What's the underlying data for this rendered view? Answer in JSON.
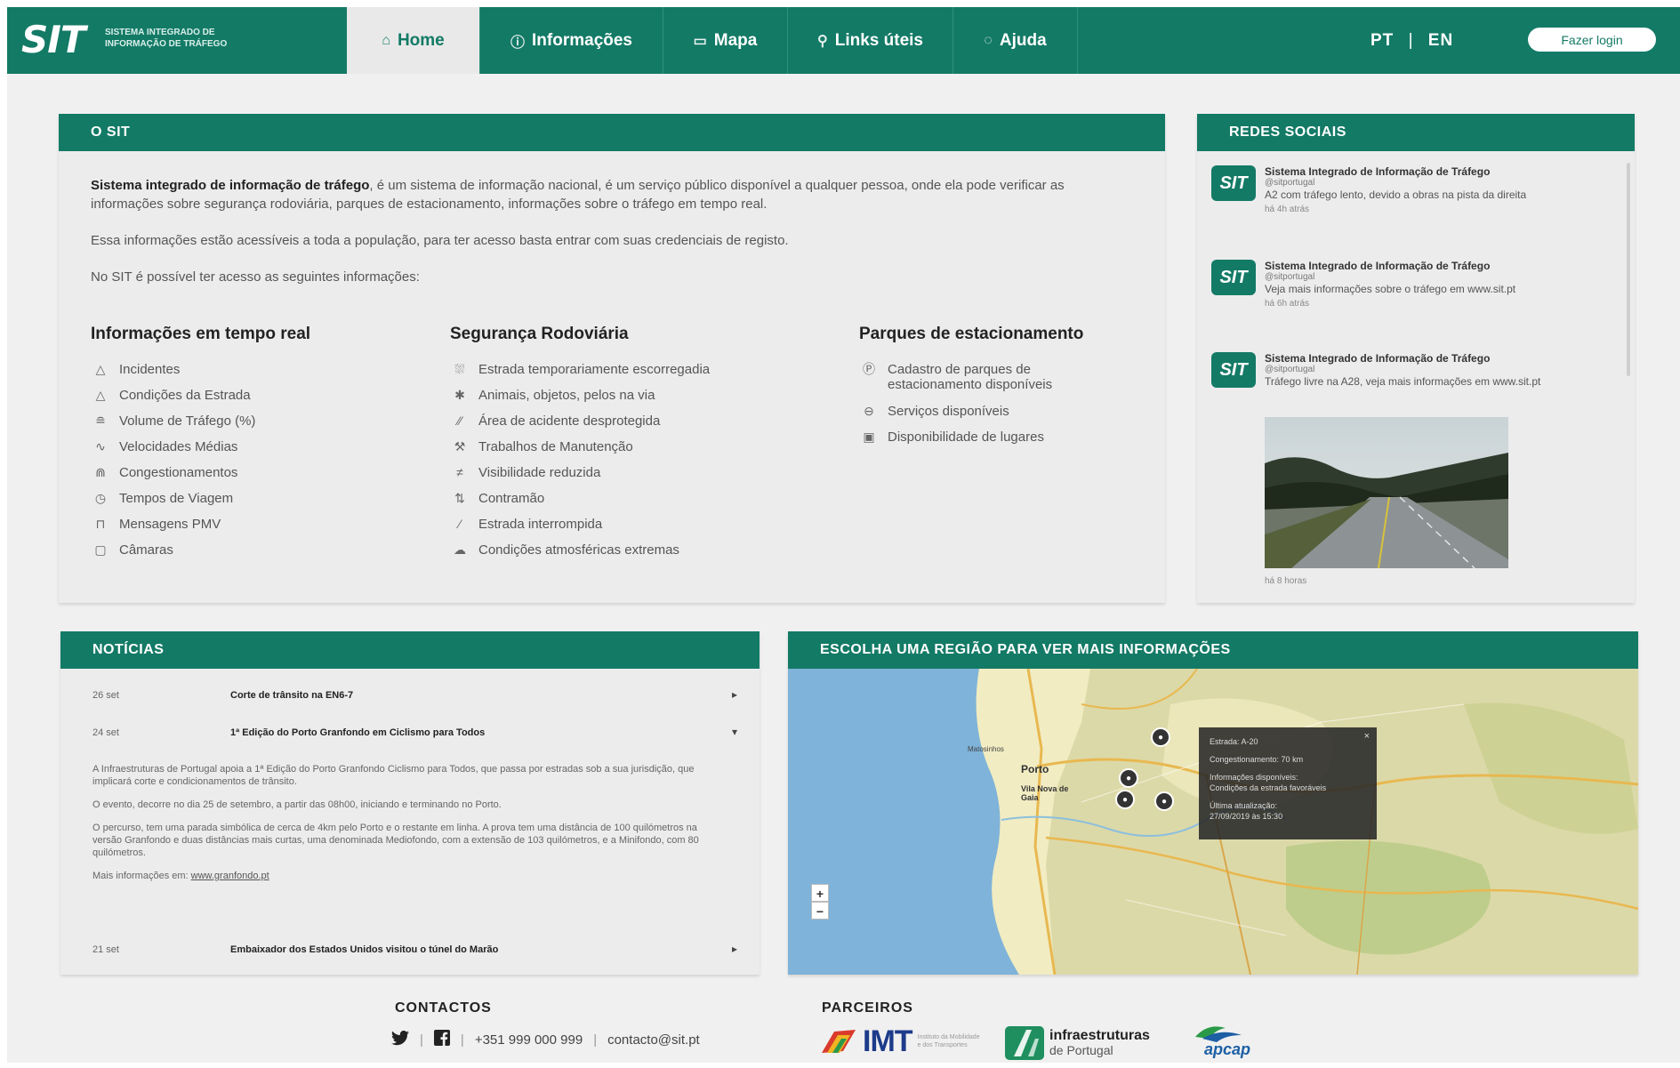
{
  "header": {
    "logo": "SIT",
    "logo_sub": "Sistema Integrado de Informação de Tráfego",
    "tabs": [
      {
        "label": "Home",
        "icon": "home-icon"
      },
      {
        "label": "Informações",
        "icon": "info-icon"
      },
      {
        "label": "Mapa",
        "icon": "map-icon"
      },
      {
        "label": "Links úteis",
        "icon": "link-icon"
      },
      {
        "label": "Ajuda",
        "icon": "help-icon"
      }
    ],
    "lang_pt": "PT",
    "lang_sep": "|",
    "lang_en": "EN",
    "login": "Fazer login"
  },
  "sit": {
    "heading": "O SIT",
    "intro_bold": "Sistema integrado de informação de tráfego",
    "intro_rest": ", é um sistema de informação nacional, é um serviço público disponível a qualquer pessoa, onde ela pode verificar as informações sobre segurança rodoviária, parques de estacionamento, informações sobre o tráfego em tempo real.",
    "para2": "Essa informações estão acessíveis a toda a população, para ter acesso basta entrar com suas credenciais de registo.",
    "para3": "No SIT é possível ter acesso as seguintes informações:",
    "columns": [
      {
        "title": "Informações em tempo real",
        "items": [
          {
            "icon": "warning-icon",
            "label": "Incidentes"
          },
          {
            "icon": "road-warning-icon",
            "label": "Condições da Estrada"
          },
          {
            "icon": "traffic-volume-icon",
            "label": "Volume de Tráfego (%)"
          },
          {
            "icon": "speed-icon",
            "label": "Velocidades Médias"
          },
          {
            "icon": "congestion-icon",
            "label": "Congestionamentos"
          },
          {
            "icon": "clock-icon",
            "label": "Tempos de Viagem"
          },
          {
            "icon": "pmv-sign-icon",
            "label": "Mensagens PMV"
          },
          {
            "icon": "camera-icon",
            "label": "Câmaras"
          }
        ]
      },
      {
        "title": "Segurança Rodoviária",
        "items": [
          {
            "icon": "slippery-road-icon",
            "label": "Estrada temporariamente escorregadia"
          },
          {
            "icon": "animal-icon",
            "label": "Animais, objetos, pelos na via"
          },
          {
            "icon": "accident-area-icon",
            "label": "Área de acidente desprotegida"
          },
          {
            "icon": "roadworks-icon",
            "label": "Trabalhos de Manutenção"
          },
          {
            "icon": "low-visibility-icon",
            "label": "Visibilidade reduzida"
          },
          {
            "icon": "wrong-way-icon",
            "label": "Contramão"
          },
          {
            "icon": "road-closed-icon",
            "label": "Estrada interrompida"
          },
          {
            "icon": "weather-icon",
            "label": "Condições atmosféricas extremas"
          }
        ]
      },
      {
        "title": "Parques de estacionamento",
        "items": [
          {
            "icon": "parking-icon",
            "label": "Cadastro de parques de estacionamento disponíveis"
          },
          {
            "icon": "services-icon",
            "label": "Serviços disponíveis"
          },
          {
            "icon": "availability-icon",
            "label": "Disponibilidade de lugares"
          }
        ]
      }
    ]
  },
  "social": {
    "heading": "Redes Sociais",
    "tweets": [
      {
        "logo": "SIT",
        "name": "Sistema Integrado de Informação de Tráfego",
        "handle": "@sitportugal",
        "text": "A2 com tráfego lento, devido a obras na pista da direita",
        "time": "há 4h atrás"
      },
      {
        "logo": "SIT",
        "name": "Sistema Integrado de Informação de Tráfego",
        "handle": "@sitportugal",
        "text": "Veja mais informações sobre o tráfego em www.sit.pt",
        "time": "há 6h atrás"
      },
      {
        "logo": "SIT",
        "name": "Sistema Integrado de Informação de Tráfego",
        "handle": "@sitportugal",
        "text": "Tráfego livre na A28, veja mais informações em www.sit.pt",
        "time": "há 8 horas"
      }
    ]
  },
  "news": {
    "heading": "Notícias",
    "items": [
      {
        "date": "26 set",
        "title": "Corte de trânsito na EN6-7",
        "chevron": "▸"
      },
      {
        "date": "24 set",
        "title": "1ª Edição do Porto Granfondo em Ciclismo para Todos",
        "chevron": "▾"
      },
      {
        "date": "21 set",
        "title": "Embaixador dos Estados Unidos visitou o túnel do Marão",
        "chevron": "▸"
      }
    ],
    "expanded": {
      "p1": "A Infraestruturas de Portugal apoia a 1ª Edição do Porto Granfondo Ciclismo para Todos, que passa por estradas sob a sua jurisdição, que implicará corte e condicionamentos de trânsito.",
      "p2": "O evento, decorre no dia 25 de setembro, a partir das 08h00, iniciando e terminando no Porto.",
      "p3": "O percurso, tem uma parada simbólica de cerca de 4km pelo Porto e o restante em linha. A prova tem uma distância de 100 quilómetros na versão Granfondo e duas distâncias mais curtas, uma denominada Mediofondo, com a extensão de 103 quilómetros, e a Minifondo, com 80 quilómetros.",
      "more_label": "Mais informações em:",
      "more_link": "www.granfondo.pt"
    }
  },
  "map": {
    "heading": "Escolha uma região para ver mais informações",
    "zoom_in": "+",
    "zoom_out": "−",
    "cities": {
      "porto": "Porto",
      "gaia": "Vila Nova de Gaia",
      "matosinhos": "Matosinhos"
    },
    "popup": {
      "close": "×",
      "line1": "Estrada: A-20",
      "line2": "Congestionamento: 70 km",
      "line3a": "Informações disponíveis:",
      "line3b": "Condições da estrada favoráveis",
      "line4a": "Última atualização:",
      "line4b": "27/09/2019 às 15:30"
    },
    "colors": {
      "sea": "#7fb3d9",
      "land": "#dcd9a8",
      "urban": "#f1ecc2",
      "roads": "#e8b850",
      "forest": "#b7c983"
    }
  },
  "footer": {
    "contacts_heading": "CONTACTOS",
    "twitter_icon": "twitter-icon",
    "facebook_icon": "facebook-icon",
    "phone": "+351 999 000 999",
    "email": "contacto@sit.pt",
    "partners_heading": "PARCEIROS",
    "imt": "IMT",
    "imt_sub": "Instituto da Mobilidade e dos Transportes",
    "ip_line1": "infraestruturas",
    "ip_line2": "de Portugal",
    "apcap": "apcap"
  },
  "colors": {
    "brand": "#137a66",
    "background": "#f0f0f0",
    "panel": "#ececec"
  }
}
